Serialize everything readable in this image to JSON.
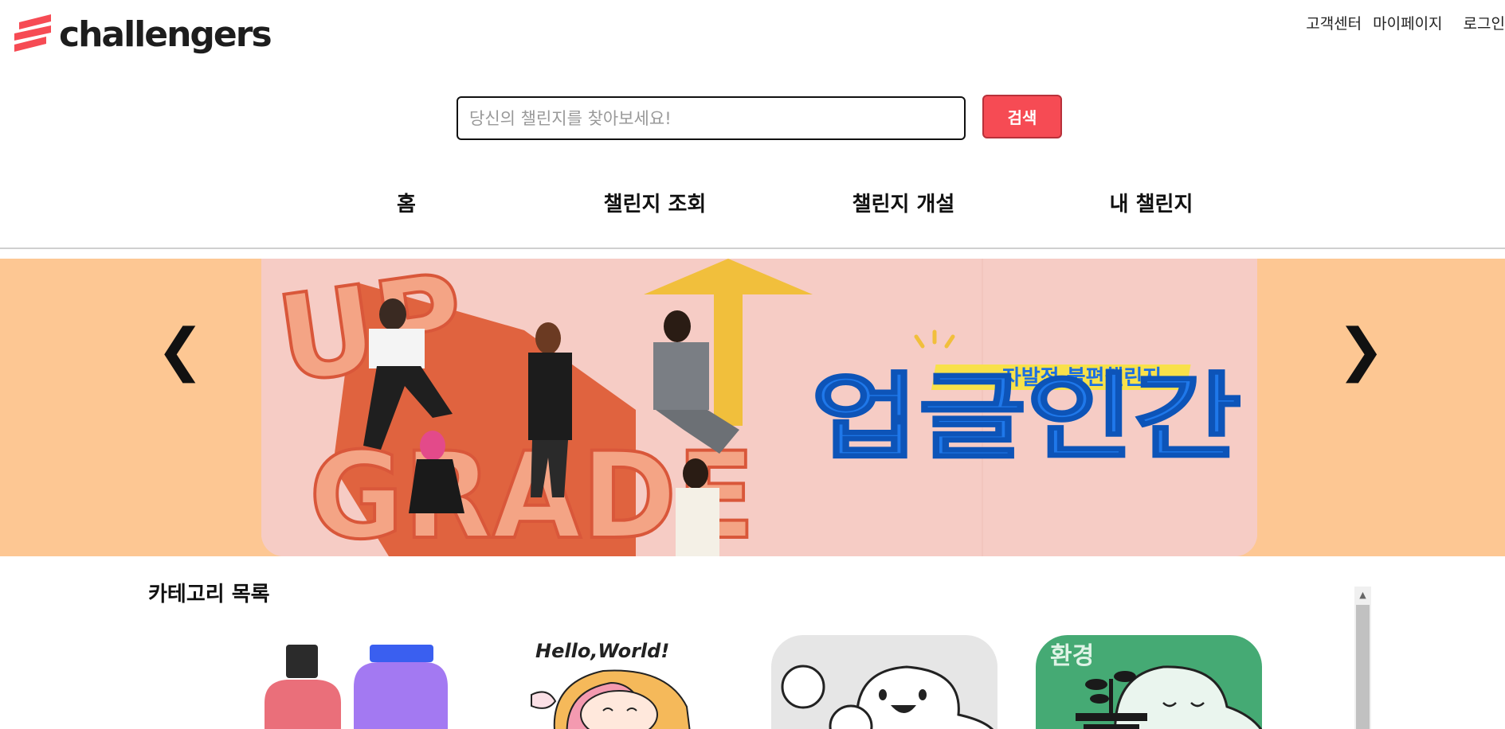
{
  "brand": {
    "name": "challengers",
    "color": "#f64b54"
  },
  "top_links": {
    "support": "고객센터",
    "mypage": "마이페이지",
    "login": "로그인"
  },
  "search": {
    "placeholder": "당신의 챌린지를 찾아보세요!",
    "button_label": "검색"
  },
  "nav": {
    "home": "홈",
    "browse": "챌린지 조회",
    "create": "챌린지 개설",
    "mine": "내 챌린지"
  },
  "banner": {
    "prev_label": "❮",
    "next_label": "❯",
    "art_text": {
      "up": "UP",
      "grade": "GRADE",
      "subtitle": "자발적 불편챌린지",
      "title": "업글인간"
    },
    "background": "#fdc793"
  },
  "categories": {
    "title": "카테고리 목록",
    "items": [
      {
        "icon": "bottles-icon"
      },
      {
        "icon": "hello-world-icon",
        "text": "Hello,World!"
      },
      {
        "icon": "cheer-icon"
      },
      {
        "icon": "environment-icon",
        "text": "환경"
      }
    ]
  }
}
